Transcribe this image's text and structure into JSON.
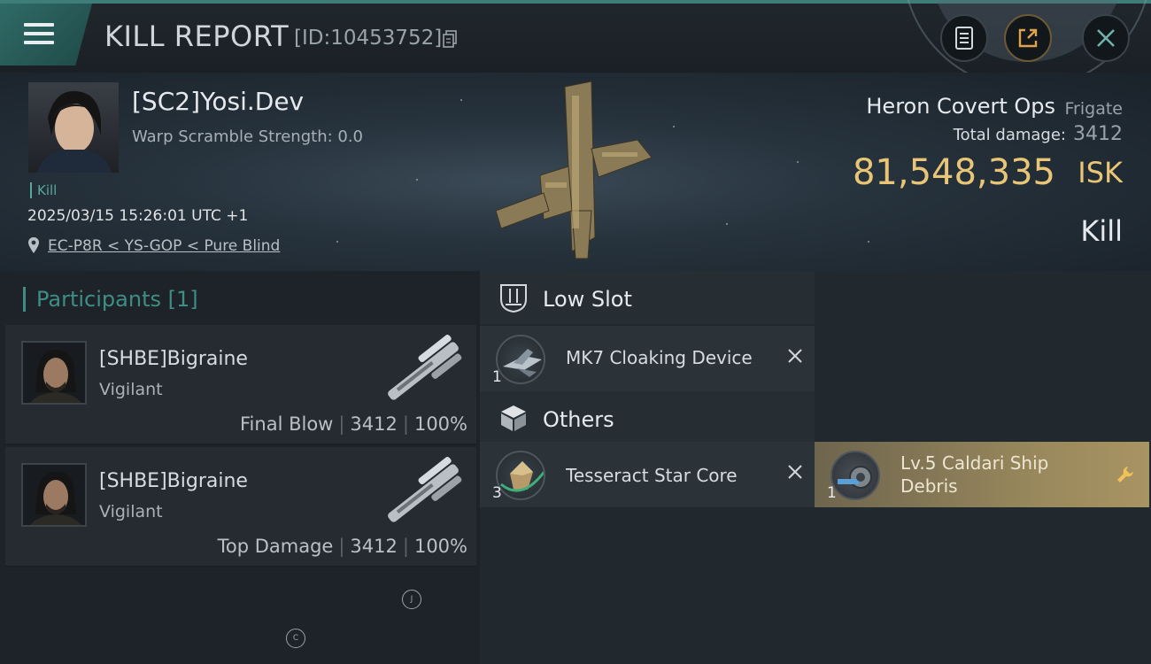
{
  "header": {
    "title": "KILL REPORT",
    "report_id": "[ID:10453752]"
  },
  "victim": {
    "pilot_name": "[SC2]Yosi.Dev",
    "warp_scramble": "Warp Scramble Strength: 0.0",
    "kill_tag": "Kill",
    "timestamp": "2025/03/15 15:26:01 UTC +1",
    "location": "EC-P8R < YS-GOP < Pure Blind",
    "ship_name": "Heron Covert Ops",
    "ship_class": "Frigate",
    "total_damage_label": "Total damage:",
    "total_damage_value": "3412",
    "isk_value": "81,548,335",
    "isk_unit": "ISK",
    "result": "Kill"
  },
  "participants": {
    "header": "Participants [1]",
    "rows": [
      {
        "name": "[SHBE]Bigraine",
        "ship": "Vigilant",
        "role": "Final Blow",
        "damage": "3412",
        "percent": "100%"
      },
      {
        "name": "[SHBE]Bigraine",
        "ship": "Vigilant",
        "role": "Top Damage",
        "damage": "3412",
        "percent": "100%"
      }
    ],
    "markers": [
      "J",
      "C"
    ]
  },
  "items": {
    "low_slot": {
      "label": "Low Slot",
      "entries": [
        {
          "name": "MK7 Cloaking Device",
          "qty": "1",
          "status": "destroyed"
        }
      ]
    },
    "others": {
      "label": "Others",
      "entries": [
        {
          "name": "Tesseract Star Core",
          "qty": "3",
          "status": "destroyed"
        },
        {
          "name_line1": "Lv.5 Caldari Ship",
          "name_line2": "Debris",
          "qty": "1",
          "status": "dropped"
        }
      ]
    }
  },
  "colors": {
    "accent": "#3f7e78",
    "isk_gold": "#e9c676",
    "kill_green": "#5aa89c",
    "dropped_gold": "#9b8a5d"
  },
  "icons": [
    "menu-icon",
    "copy-icon",
    "notes-icon",
    "share-icon",
    "close-icon",
    "location-pin-icon",
    "low-slot-icon",
    "cube-icon",
    "destroyed-x-icon",
    "wrench-icon"
  ]
}
